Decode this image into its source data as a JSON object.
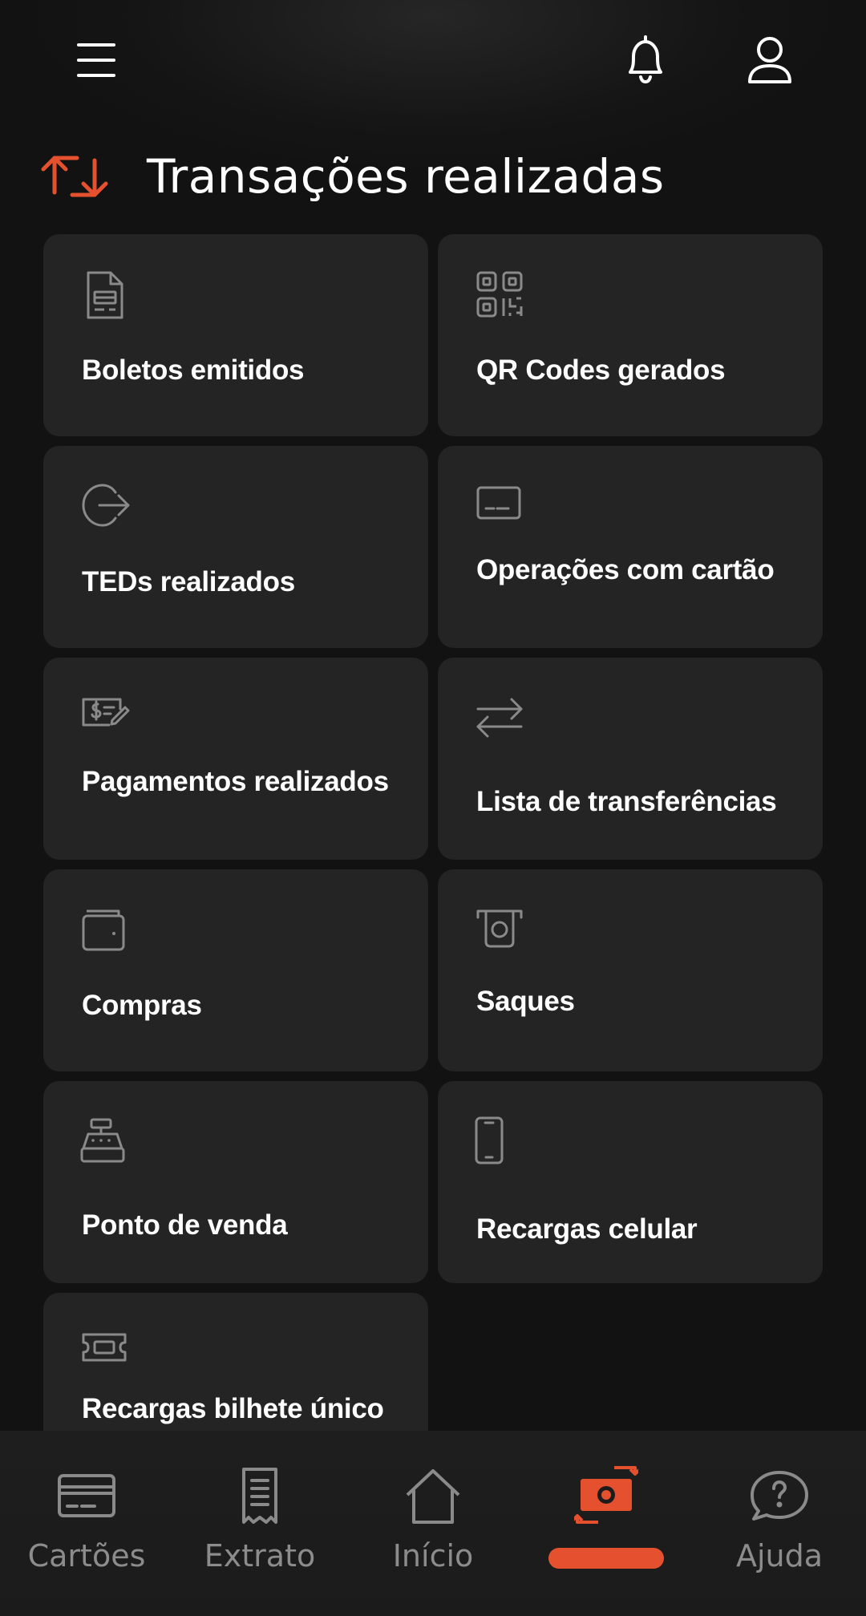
{
  "header": {
    "title": "Transações realizadas"
  },
  "tiles": [
    {
      "label": "Boletos emitidos",
      "icon": "bill-document-icon"
    },
    {
      "label": "QR Codes gerados",
      "icon": "qr-code-icon"
    },
    {
      "label": "TEDs realizados",
      "icon": "transfer-out-icon"
    },
    {
      "label": "Operações com cartão",
      "icon": "card-icon"
    },
    {
      "label": "Pagamentos realizados",
      "icon": "payment-check-icon"
    },
    {
      "label": "Lista de transferências",
      "icon": "swap-arrows-icon"
    },
    {
      "label": "Compras",
      "icon": "wallet-icon"
    },
    {
      "label": "Saques",
      "icon": "atm-withdraw-icon"
    },
    {
      "label": "Ponto de venda",
      "icon": "cash-register-icon"
    },
    {
      "label": "Recargas celular",
      "icon": "phone-icon"
    },
    {
      "label": "Recargas bilhete único",
      "icon": "ticket-icon"
    }
  ],
  "bottom_nav": [
    {
      "label": "Cartões",
      "icon": "card-icon"
    },
    {
      "label": "Extrato",
      "icon": "receipt-icon"
    },
    {
      "label": "Início",
      "icon": "home-icon"
    },
    {
      "label": "",
      "icon": "money-transfer-icon",
      "active": true
    },
    {
      "label": "Ajuda",
      "icon": "help-chat-icon"
    }
  ],
  "colors": {
    "background": "#121212",
    "tile": "#242424",
    "accent": "#e5512f",
    "icon_gray": "#8a8a8a",
    "nav_label": "#8c8c8c"
  }
}
